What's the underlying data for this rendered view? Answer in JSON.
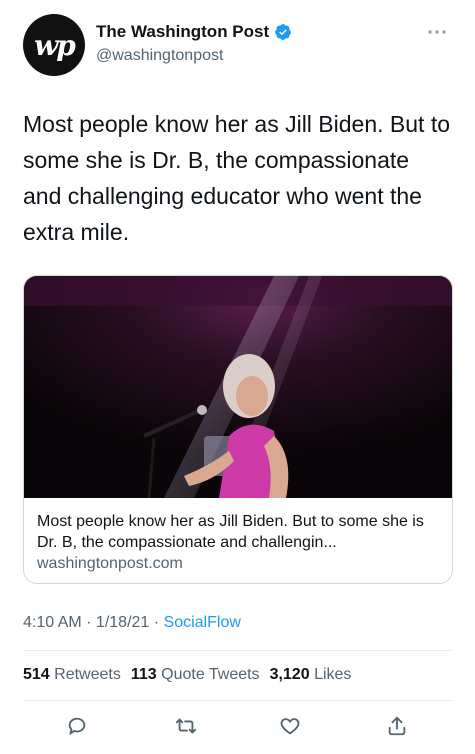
{
  "author": {
    "avatar_text": "wp",
    "display_name": "The Washington Post",
    "handle": "@washingtonpost",
    "verified_icon": "verified-badge-icon",
    "verified_color": "#1d9bf0"
  },
  "tweet": {
    "text": "Most people know her as Jill Biden. But to some she is Dr. B, the compassionate and challenging educator who went the extra mile."
  },
  "card": {
    "title": "Most people know her as Jill Biden. But to some she is Dr. B, the compassionate and challengin...",
    "domain": "washingtonpost.com"
  },
  "meta": {
    "time": "4:10 AM",
    "sep1": " · ",
    "date": "1/18/21",
    "sep2": " · ",
    "source": "SocialFlow"
  },
  "stats": {
    "retweets_count": "514",
    "retweets_label": "Retweets",
    "quotes_count": "113",
    "quotes_label": "Quote Tweets",
    "likes_count": "3,120",
    "likes_label": "Likes"
  },
  "icons": {
    "more": "more-icon",
    "reply": "reply-icon",
    "retweet": "retweet-icon",
    "like": "like-icon",
    "share": "share-icon"
  },
  "colors": {
    "text": "#0f1419",
    "secondary": "#536471",
    "accent": "#1d9bf0",
    "border": "#cfd9de"
  }
}
